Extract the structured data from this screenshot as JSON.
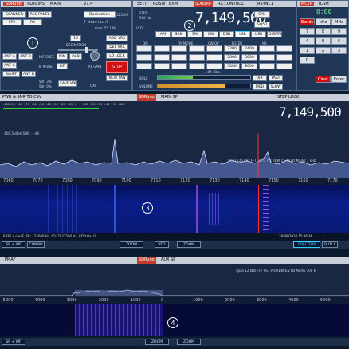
{
  "top_left_panel": {
    "title_tabs": [
      "SDRuno",
      "PLUGINS",
      "MAIN",
      "V1.4"
    ],
    "buttons": [
      "SCANNER",
      "REC PANEL",
      "SP2",
      "RX",
      "ADD VRX",
      "DEL VRX",
      "LO LOCK",
      "STOP",
      "NEW PAN",
      "ANT A",
      "ANT B",
      "ANT C",
      "BIAS-T",
      "ANT D",
      "NOTCHES",
      "NW",
      "DAB",
      "IF MODE",
      "LIF",
      "SAVE WKS"
    ],
    "decimation_label": "DECIMATION",
    "decimation_value": "16",
    "decimation_tooltip": "Decimation",
    "sample_rate": "125000",
    "if_mode_text": "IF Mode: Low IF",
    "gain_text": "Gain: 55.1dB",
    "sdr_line1": "Sdr: 3%",
    "sdr_line2": "Sdr: 0%",
    "rf_gain_label": "RF GAIN",
    "dxc": "DXC"
  },
  "rx_control": {
    "title_tabs": [
      "SETT.",
      "RDSW",
      "EXM",
      "SDRuno",
      "RX CONTROL",
      "RSYNC1",
      "MCTR",
      "TCSM"
    ],
    "frequency": "7,149,500",
    "step_label": "STEP:",
    "step_value": "500 Hz",
    "vfo_label": "VFO",
    "modes": [
      "AM",
      "SAM",
      "FM",
      "CW",
      "DSB",
      "LSB",
      "USB",
      "DIGITAL"
    ],
    "qm_label": "QM",
    "fm_mode_label": "FM MODE",
    "cw_op_label": "CW OP",
    "filter_label": "FILTER",
    "nr_label": "NR",
    "nr_value": "-10",
    "nbw_label": "NBW",
    "nbw_value": "10",
    "sliders": [
      "SQLC",
      "VOLUME"
    ],
    "signal_db": "-84 dBm",
    "snr_db": "5.1 dB",
    "row_buttons": [
      "SM4",
      "SQ50",
      "5S/NS",
      "NB",
      "AGC",
      "OFF",
      "FAST",
      "MED",
      "SLOW"
    ],
    "lcd_top": "0:00",
    "keypad": [
      "Bands",
      "kHz",
      "MHz",
      "7",
      "8",
      "9",
      "4",
      "5",
      "6",
      "1",
      "2",
      "3",
      "0",
      "Clear",
      "Enter"
    ],
    "vfo_presets": [
      "2200",
      "2400",
      "2800",
      "3000",
      "5000",
      "8000"
    ]
  },
  "main_spectrum": {
    "toolbar_left": "PWR & SNR TO CSV",
    "title": "SDRuno",
    "title_sub": "MAIN SP",
    "step_lock": "STEP LOCK",
    "frequency": "7,149,500",
    "scale_labels": [
      "-100",
      "-90",
      "-80",
      "-70",
      "-60",
      "-50",
      "-40",
      "-30",
      "-20",
      "-10",
      "0",
      "+10",
      "+20",
      "+30",
      "+40",
      "+50",
      "+60"
    ],
    "level_text": "-100.5 dBm    SNR: -- dB",
    "span_info": "Span 125 kHz   FFT 8192 Pts   RBW 15.26 Hz   Marks 1 kHz",
    "freq_axis": [
      "7060",
      "7070",
      "7080",
      "7090",
      "7100",
      "7110",
      "7120",
      "7130",
      "7140",
      "7150",
      "7160",
      "7170"
    ],
    "status_line": "RSP1 (Low-IF, SR: 125000 Hz, LO: 7022500 Hz, RFState: 0)",
    "timestamp": "18/08/2020 15:36:46",
    "bottom_buttons": [
      "SP + WF",
      "COMBO",
      "ZOOM",
      "VFO",
      "ZOOM",
      "SQLC THR",
      "QUTLE"
    ]
  },
  "aux_spectrum": {
    "toolbar_left": "PMAF",
    "title": "SDRuno",
    "title_sub": "AUX SP",
    "span_info": "Span 12 kHz    FFT 967 Pts    RBW 6.2 Hz    Marks 100 H",
    "freq_axis": [
      "-5000",
      "-4000",
      "-3000",
      "-2000",
      "-1000",
      "0",
      "1000",
      "2000",
      "3000",
      "4000",
      "5000"
    ],
    "bottom_buttons": [
      "SP + WF",
      "ZOOM",
      "ZOOM"
    ]
  },
  "markers": [
    "1",
    "2",
    "3",
    "4"
  ]
}
